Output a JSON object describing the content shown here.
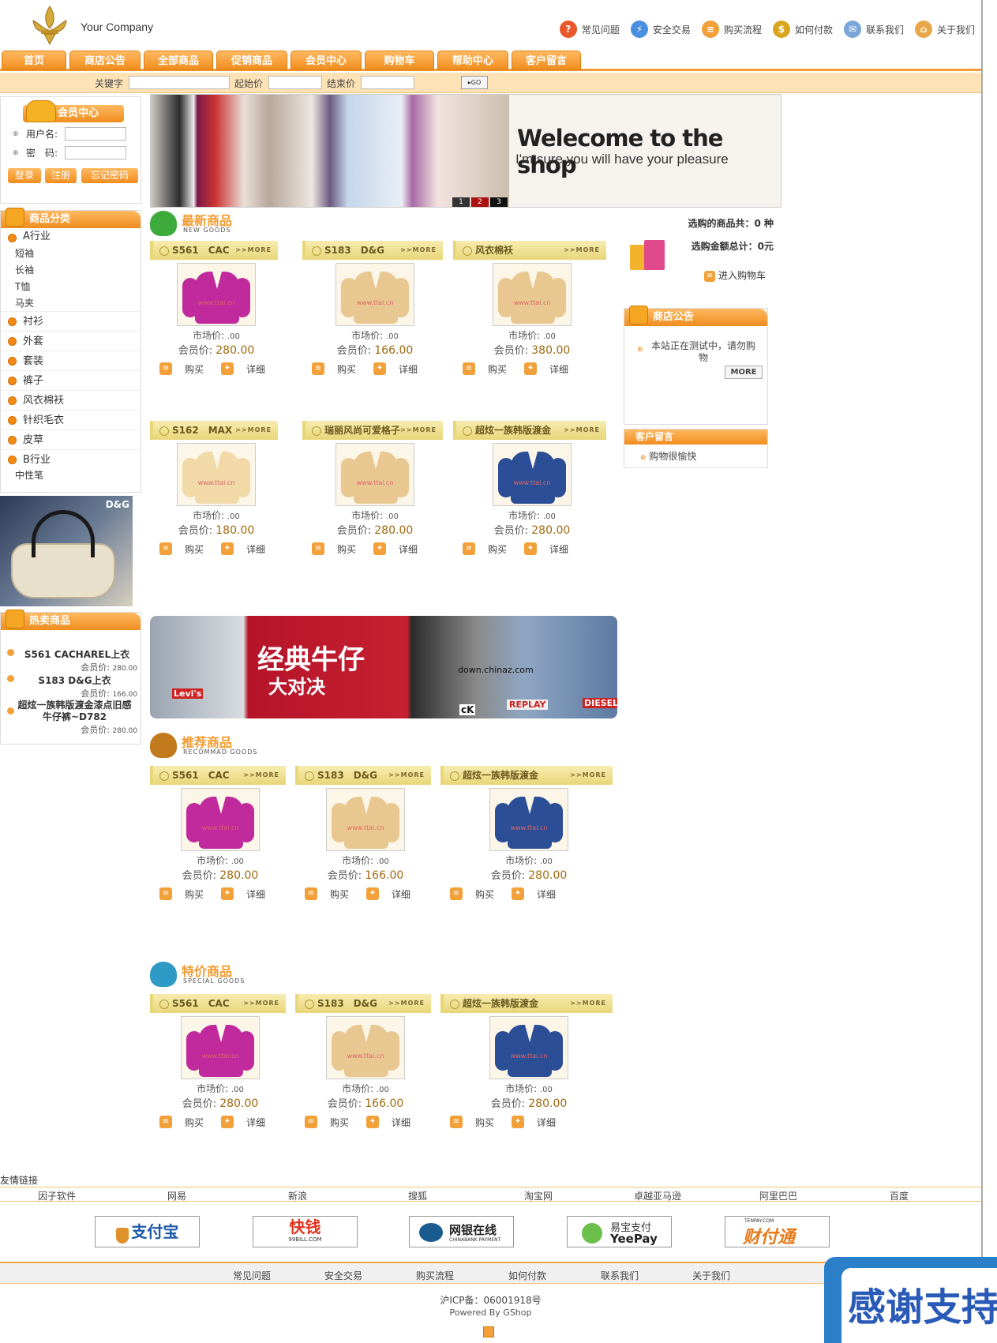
{
  "header": {
    "logo_text": "Your Company",
    "top_links": [
      {
        "label": "常见问题",
        "icon": "question-icon",
        "color": "#e8582a"
      },
      {
        "label": "安全交易",
        "icon": "lightning-icon",
        "color": "#4b8fe0"
      },
      {
        "label": "购买流程",
        "icon": "cart-icon",
        "color": "#f2a13a"
      },
      {
        "label": "如何付款",
        "icon": "money-bag-icon",
        "color": "#d9a520"
      },
      {
        "label": "联系我们",
        "icon": "mail-icon",
        "color": "#7aa7d8"
      },
      {
        "label": "关于我们",
        "icon": "home-icon",
        "color": "#e8a84a"
      }
    ]
  },
  "nav": {
    "tabs": [
      "首页",
      "商店公告",
      "全部商品",
      "促销商品",
      "会员中心",
      "购物车",
      "帮助中心",
      "客户留言"
    ]
  },
  "search": {
    "keyword_label": "关键字",
    "min_price_label": "起始价",
    "max_price_label": "结束价",
    "go_label": "GO"
  },
  "banner": {
    "headline": "Welecome to the shop",
    "subline": "I'm sure you will have your pleasure",
    "pages": [
      "1",
      "2",
      "3"
    ]
  },
  "member": {
    "title": "会员中心",
    "username_label": "用户名:",
    "password_label": "密　码:",
    "login_label": "登录",
    "register_label": "注册",
    "forgot_label": "忘记密码"
  },
  "categories": {
    "title": "商品分类",
    "groups": [
      {
        "label": "A行业",
        "subs": [
          "短袖",
          "长袖",
          "T恤",
          "马夹"
        ]
      },
      {
        "label": "衬衫",
        "subs": []
      },
      {
        "label": "外套",
        "subs": []
      },
      {
        "label": "套装",
        "subs": []
      },
      {
        "label": "裤子",
        "subs": []
      },
      {
        "label": "风衣棉袄",
        "subs": []
      },
      {
        "label": "针织毛衣",
        "subs": []
      },
      {
        "label": "皮草",
        "subs": []
      },
      {
        "label": "B行业",
        "subs": [
          "中性笔"
        ]
      }
    ]
  },
  "ad_bag_text": "D&G",
  "hot": {
    "title": "热卖商品",
    "items": [
      {
        "name": "S561 CACHAREL上衣",
        "price_label": "会员价:",
        "price": "280.00"
      },
      {
        "name": "S183 D&G上衣",
        "price_label": "会员价:",
        "price": "166.00"
      },
      {
        "name": "超炫一族韩版渡金漆点旧感牛仔裤~D782",
        "price_label": "会员价:",
        "price": "280.00"
      }
    ]
  },
  "labels": {
    "market_price": "市场价:",
    "member_price": "会员价:",
    "buy": "购买",
    "detail": "详细",
    "more": ">>MORE",
    "watermark": "www.ttai.cn"
  },
  "new_goods": {
    "title": "最新商品",
    "subtitle": "NEW GOODS",
    "products": [
      {
        "name": "S561　CAC",
        "market": ".00",
        "member": "280.00",
        "color": "#c02a9c"
      },
      {
        "name": "S183　D&G",
        "market": ".00",
        "member": "166.00",
        "color": "#e8c890"
      },
      {
        "name": "风衣棉袄",
        "market": ".00",
        "member": "380.00",
        "color": "#e8c890"
      },
      {
        "name": "S162　MAX",
        "market": ".00",
        "member": "180.00",
        "color": "#f1d9a8"
      },
      {
        "name": "瑞丽风尚可爱格子",
        "market": ".00",
        "member": "280.00",
        "color": "#e8c890"
      },
      {
        "name": "超炫一族韩版渡金",
        "market": ".00",
        "member": "280.00",
        "color": "#2b4e96"
      }
    ]
  },
  "jeans_banner": {
    "headline": "经典牛仔",
    "sub": "大对决",
    "url_text": "down.chinaz.com",
    "brands": [
      "REPLAY",
      "DIESEL",
      "cK",
      "Levi's"
    ]
  },
  "recommend": {
    "title": "推荐商品",
    "subtitle": "RECOMMAD GOODS",
    "products": [
      {
        "name": "S561　CAC",
        "market": ".00",
        "member": "280.00",
        "color": "#c02a9c"
      },
      {
        "name": "S183　D&G",
        "market": ".00",
        "member": "166.00",
        "color": "#e8c890"
      },
      {
        "name": "超炫一族韩版渡金",
        "market": ".00",
        "member": "280.00",
        "color": "#2b4e96"
      }
    ]
  },
  "special": {
    "title": "特价商品",
    "subtitle": "SPECIAL GOODS",
    "products": [
      {
        "name": "S561　CAC",
        "market": ".00",
        "member": "280.00",
        "color": "#c02a9c"
      },
      {
        "name": "S183　D&G",
        "market": ".00",
        "member": "166.00",
        "color": "#e8c890"
      },
      {
        "name": "超炫一族韩版渡金",
        "market": ".00",
        "member": "280.00",
        "color": "#2b4e96"
      }
    ]
  },
  "cart": {
    "count_text": "选购的商品共：0 种",
    "total_text": "选购金额总计：0元",
    "enter_label": "进入购物车"
  },
  "notice": {
    "title": "商店公告",
    "text": "本站正在测试中，请勿购物",
    "more_label": "MORE"
  },
  "messages": {
    "title": "客户留言",
    "items": [
      "购物很愉快"
    ]
  },
  "friend_links": {
    "title": "友情链接",
    "links": [
      "因子软件",
      "网易",
      "新浪",
      "搜狐",
      "淘宝网",
      "卓越亚马逊",
      "阿里巴巴",
      "百度"
    ]
  },
  "payments": [
    {
      "label": "支付宝",
      "color": "#1c5aa8"
    },
    {
      "label": "快钱",
      "sub": "99BILL.COM",
      "color": "#e2321c"
    },
    {
      "label": "网银在线",
      "sub": "CHINABANK PAYMENT",
      "color": "#222"
    },
    {
      "label": "易宝支付",
      "sub": "YeePay",
      "color": "#3a9a3a"
    },
    {
      "label": "财付通",
      "sub": "TENPAY.COM",
      "color": "#e57a1a"
    }
  ],
  "footer": {
    "links": [
      "常见问题",
      "安全交易",
      "购买流程",
      "如何付款",
      "联系我们",
      "关于我们"
    ],
    "icp": "沪ICP备：06001918号",
    "powered": "Powered By GShop"
  },
  "corner_banner": "感谢支持"
}
